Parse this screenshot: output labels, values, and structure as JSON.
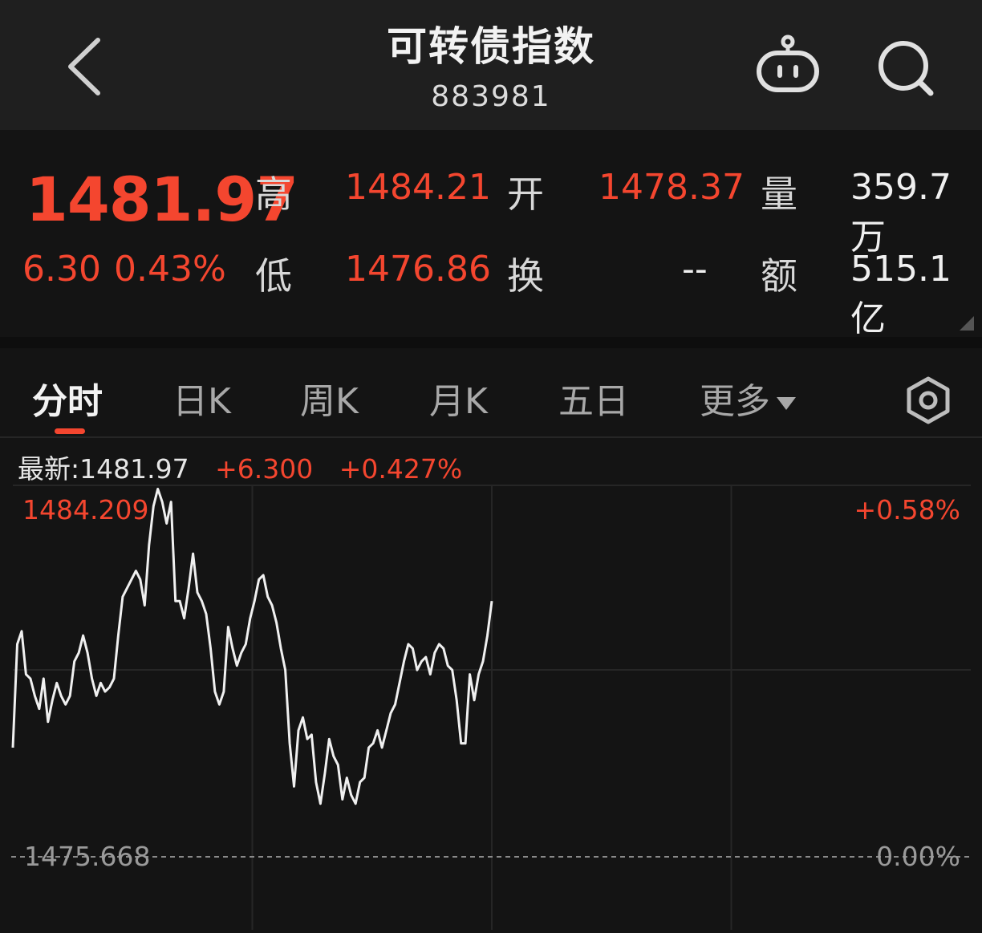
{
  "header": {
    "title": "可转债指数",
    "code": "883981"
  },
  "quote": {
    "price": "1481.97",
    "change": "6.30",
    "change_pct": "0.43%",
    "high_label": "高",
    "high": "1484.21",
    "open_label": "开",
    "open": "1478.37",
    "volume_label": "量",
    "volume": "359.7万",
    "low_label": "低",
    "low": "1476.86",
    "turnover_label": "换",
    "turnover": "--",
    "amount_label": "额",
    "amount": "515.1亿"
  },
  "tabs": [
    {
      "label": "分时",
      "active": true
    },
    {
      "label": "日K"
    },
    {
      "label": "周K"
    },
    {
      "label": "月K"
    },
    {
      "label": "五日"
    },
    {
      "label": "更多"
    }
  ],
  "info": {
    "latest": "最新:1481.97",
    "change": "+6.300",
    "change_pct": "+0.427%"
  },
  "chart_data": {
    "type": "line",
    "y_max_label": "1484.209",
    "y_base_label": "1475.668",
    "pct_max_label": "+0.58%",
    "pct_base_label": "0.00%",
    "ylim": [
      1475.668,
      1484.209
    ],
    "x_fraction_elapsed": 0.5,
    "series": [
      {
        "values": [
          1478.2,
          1480.6,
          1480.9,
          1479.9,
          1479.8,
          1479.4,
          1479.1,
          1479.8,
          1478.8,
          1479.3,
          1479.7,
          1479.4,
          1479.2,
          1479.4,
          1480.2,
          1480.4,
          1480.8,
          1480.4,
          1479.8,
          1479.4,
          1479.7,
          1479.5,
          1479.6,
          1479.8,
          1480.8,
          1481.7,
          1481.9,
          1482.1,
          1482.3,
          1482.1,
          1481.5,
          1482.9,
          1483.8,
          1484.2,
          1483.9,
          1483.4,
          1483.9,
          1481.6,
          1481.6,
          1481.2,
          1481.9,
          1482.7,
          1481.8,
          1481.6,
          1481.3,
          1480.5,
          1479.5,
          1479.2,
          1479.5,
          1481.0,
          1480.5,
          1480.1,
          1480.4,
          1480.6,
          1481.2,
          1481.6,
          1482.1,
          1482.2,
          1481.7,
          1481.5,
          1481.1,
          1480.5,
          1480.0,
          1478.3,
          1477.3,
          1478.6,
          1478.9,
          1478.4,
          1478.5,
          1477.4,
          1476.9,
          1477.6,
          1478.4,
          1478.0,
          1477.8,
          1477.0,
          1477.5,
          1477.1,
          1476.9,
          1477.4,
          1477.5,
          1478.2,
          1478.3,
          1478.6,
          1478.2,
          1478.6,
          1479.0,
          1479.2,
          1479.7,
          1480.2,
          1480.6,
          1480.5,
          1480.0,
          1480.2,
          1480.3,
          1479.9,
          1480.4,
          1480.6,
          1480.5,
          1480.1,
          1480.0,
          1479.3,
          1478.3,
          1478.3,
          1479.9,
          1479.3,
          1479.9,
          1480.2,
          1480.8,
          1481.6
        ]
      }
    ]
  },
  "colors": {
    "up": "#f4462f",
    "background": "#141414",
    "line": "#f0f0f0"
  },
  "icons": [
    "back-chevron-icon",
    "robot-assistant-icon",
    "search-icon",
    "settings-hexagon-icon"
  ]
}
